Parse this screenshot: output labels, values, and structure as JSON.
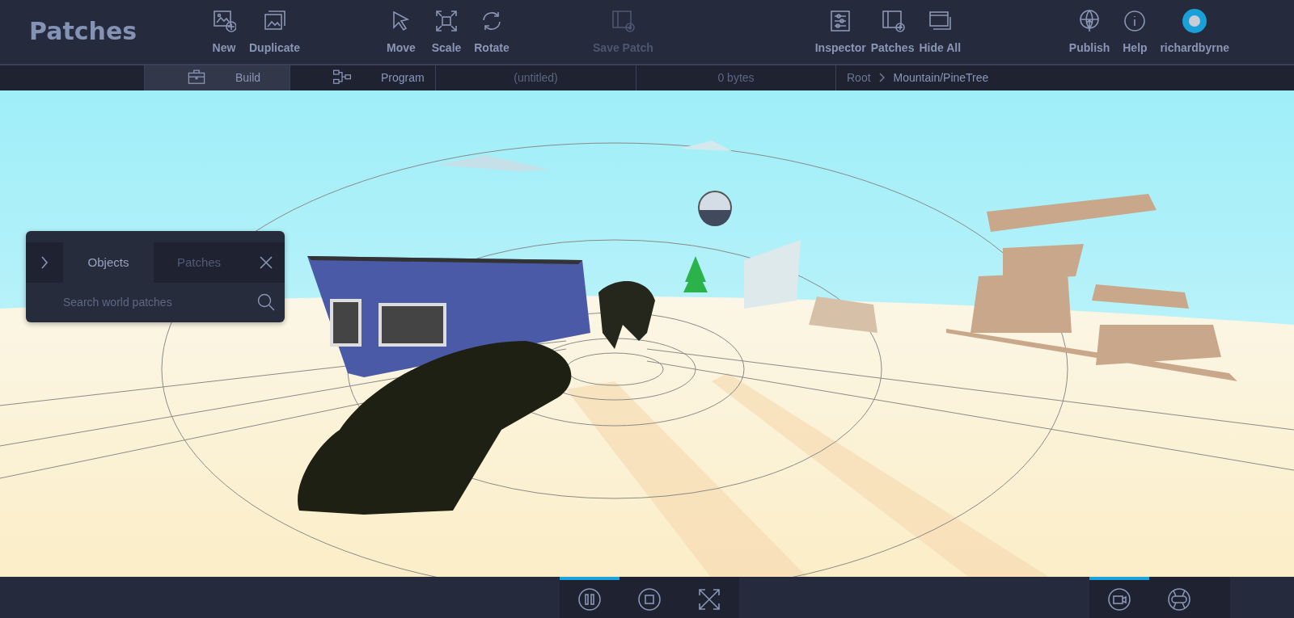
{
  "app_title": "Patches",
  "toolbar_groups": [
    {
      "items": [
        {
          "kind": "new",
          "label": "New",
          "disabled": false
        },
        {
          "kind": "duplicate",
          "label": "Duplicate",
          "disabled": false
        }
      ]
    },
    {
      "items": [
        {
          "kind": "move",
          "label": "Move",
          "disabled": false
        },
        {
          "kind": "scale",
          "label": "Scale",
          "disabled": false
        },
        {
          "kind": "rotate",
          "label": "Rotate",
          "disabled": false
        }
      ]
    },
    {
      "items": [
        {
          "kind": "save",
          "label": "Save Patch",
          "disabled": true
        }
      ]
    },
    {
      "items": [
        {
          "kind": "inspector",
          "label": "Inspector",
          "disabled": false
        },
        {
          "kind": "patches",
          "label": "Patches",
          "disabled": false
        },
        {
          "kind": "hide",
          "label": "Hide All",
          "disabled": false
        }
      ]
    },
    {
      "items": [
        {
          "kind": "publish",
          "label": "Publish",
          "disabled": false
        },
        {
          "kind": "help",
          "label": "Help",
          "disabled": false
        },
        {
          "kind": "user",
          "label": "richardbyrne",
          "disabled": false
        }
      ]
    }
  ],
  "mode_tabs": [
    {
      "kind": "build",
      "label": "Build",
      "selected": true
    },
    {
      "kind": "program",
      "label": "Program",
      "selected": false
    }
  ],
  "file_name": "(untitled)",
  "file_size": "0 bytes",
  "breadcrumb": [
    "Root",
    "Mountain/PineTree"
  ],
  "objects_panel": {
    "tabs": [
      {
        "label": "Objects",
        "selected": true
      },
      {
        "label": "Patches",
        "selected": false
      }
    ],
    "search": {
      "placeholder": "Search world patches"
    }
  },
  "playback_controls": [
    {
      "kind": "pause",
      "active": true
    },
    {
      "kind": "stop",
      "active": false
    },
    {
      "kind": "fullscreen",
      "active": false
    }
  ],
  "view_controls": [
    {
      "kind": "camera",
      "active": true
    },
    {
      "kind": "gamepad",
      "active": false
    }
  ]
}
